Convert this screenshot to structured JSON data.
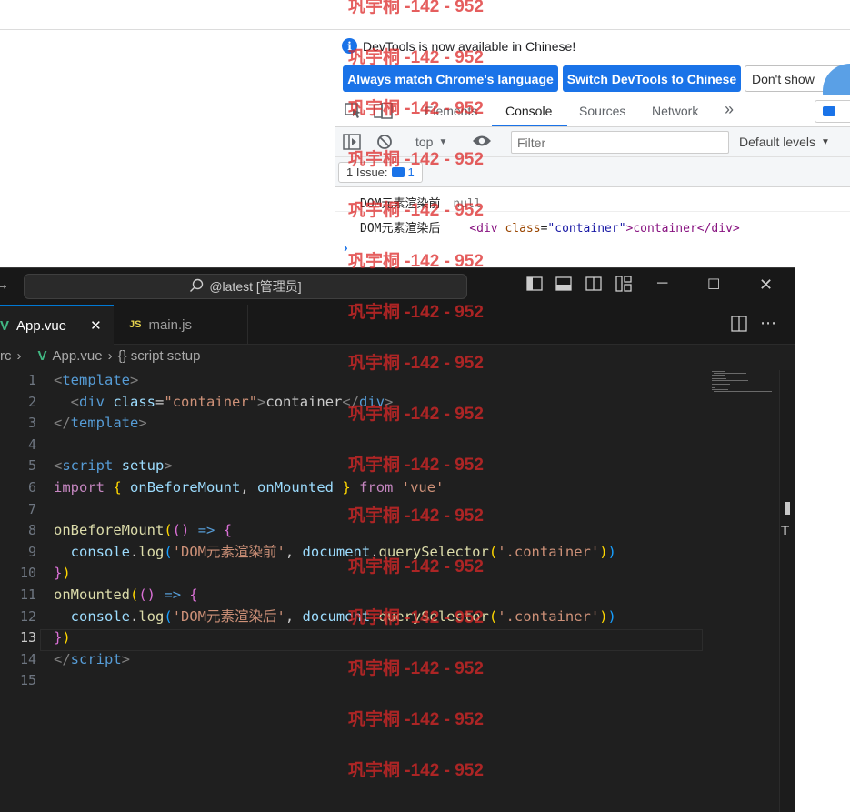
{
  "devtools": {
    "notice": "DevTools is now available in Chinese!",
    "btn_match": "Always match Chrome's language",
    "btn_switch": "Switch DevTools to Chinese",
    "btn_dontshow": "Don't show",
    "tabs": [
      "Elements",
      "Console",
      "Sources",
      "Network"
    ],
    "more_tabs": "»",
    "context": "top",
    "filter_placeholder": "Filter",
    "levels": "Default levels",
    "issues_label": "1 Issue:",
    "issues_count": "1",
    "log1_text": "DOM元素渲染前",
    "log1_value": "null",
    "log2_text": "DOM元素渲染后",
    "log2_open": "<div ",
    "log2_attr": "class",
    "log2_eq": "=",
    "log2_val": "\"container\"",
    "log2_content": ">container</div>",
    "prompt": "›",
    "accent": "#1a73e8"
  },
  "vscode": {
    "command_center": "@latest [管理员]",
    "tabs": [
      {
        "icon": "V",
        "label": "App.vue",
        "close": "✕"
      },
      {
        "icon": "JS",
        "label": "main.js"
      }
    ],
    "breadcrumb": {
      "folder": "rc",
      "file": "App.vue",
      "symbol": "{} script setup"
    },
    "line_numbers": [
      "1",
      "2",
      "3",
      "4",
      "5",
      "6",
      "7",
      "8",
      "9",
      "10",
      "11",
      "12",
      "13",
      "14",
      "15"
    ],
    "current_line": "13"
  },
  "watermark": "巩宇桐 -142 - 952"
}
